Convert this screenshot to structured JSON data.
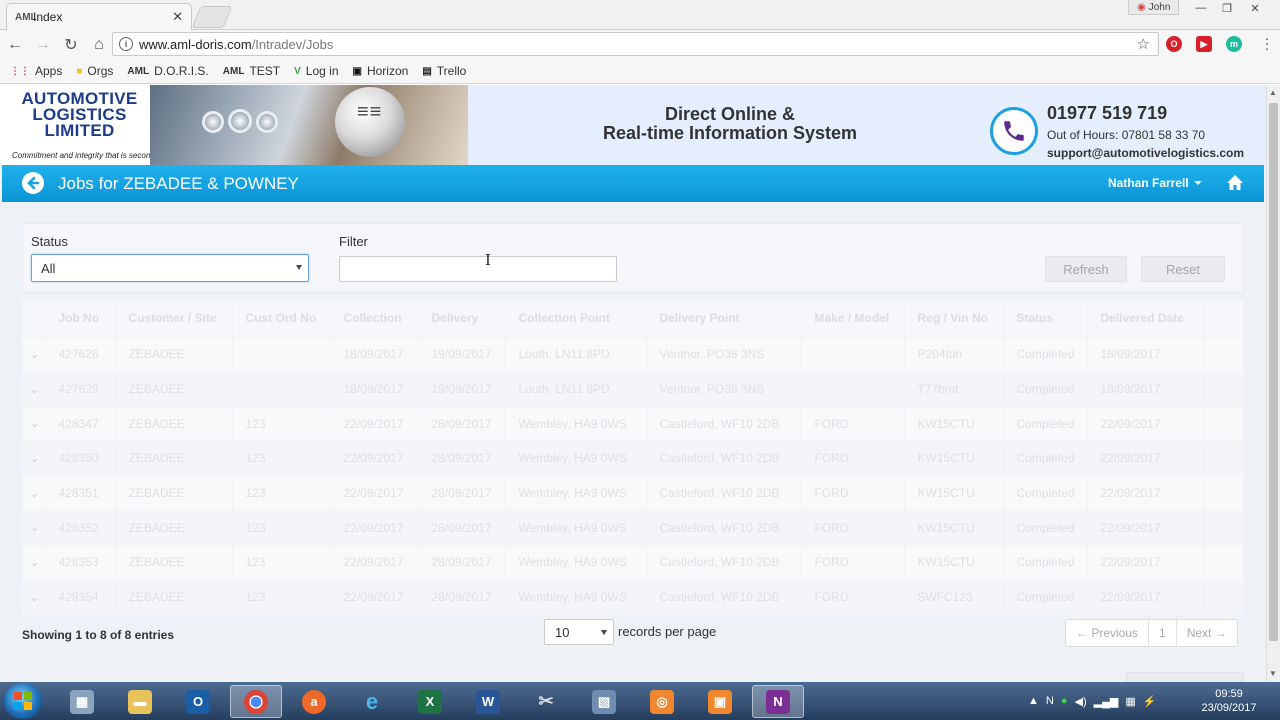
{
  "browser": {
    "tab_title": "Index",
    "tab_favicon": "AML",
    "profile_name": "John",
    "url_host": "www.aml-doris.com",
    "url_path": "/Intradev/Jobs",
    "bookmarks": [
      {
        "label": "Apps",
        "icon": "apps-grid-icon"
      },
      {
        "label": "Orgs",
        "icon": "folder-icon"
      },
      {
        "label": "D.O.R.I.S.",
        "icon": "aml-icon"
      },
      {
        "label": "TEST",
        "icon": "aml-icon"
      },
      {
        "label": "Log in",
        "icon": "vine-icon"
      },
      {
        "label": "Horizon",
        "icon": "horizon-icon"
      },
      {
        "label": "Trello",
        "icon": "trello-icon"
      }
    ]
  },
  "header": {
    "logo_lines": [
      "AUTOMOTIVE",
      "LOGISTICS",
      "LIMITED"
    ],
    "logo_tagline": "Commitment and integrity that is second to none",
    "system_title_1": "Direct Online &",
    "system_title_2": "Real-time Information System",
    "phone": "01977 519 719",
    "out_of_hours": "Out of Hours: 07801 58 33 70",
    "email": "support@automotivelogistics.com"
  },
  "bar": {
    "title": "Jobs for ZEBADEE & POWNEY",
    "user": "Nathan Farrell"
  },
  "filters": {
    "status_label": "Status",
    "status_value": "All",
    "filter_label": "Filter",
    "filter_value": "",
    "refresh_label": "Refresh",
    "reset_label": "Reset"
  },
  "table": {
    "columns": [
      "Job No",
      "Customer / Site",
      "Cust Ord No",
      "Collection",
      "Delivery",
      "Collection Point",
      "Delivery Point",
      "Make / Model",
      "Reg / Vin No",
      "Status",
      "Delivered Date"
    ],
    "rows": [
      [
        "427626",
        "ZEBADEE",
        "",
        "18/09/2017",
        "19/09/2017",
        "Louth, LN11 8PD",
        "Ventnor, PO38 3NS",
        "",
        "P204tdn",
        "Completed",
        "18/09/2017"
      ],
      [
        "427629",
        "ZEBADEE",
        "",
        "18/09/2017",
        "19/09/2017",
        "Louth, LN11 8PD",
        "Ventnor, PO38 3NS",
        "",
        "T77bmt",
        "Completed",
        "18/09/2017"
      ],
      [
        "428347",
        "ZEBADEE",
        "123",
        "22/09/2017",
        "28/09/2017",
        "Wembley, HA9 0WS",
        "Castleford, WF10 2DB",
        "FORD",
        "KW15CTU",
        "Completed",
        "22/09/2017"
      ],
      [
        "428350",
        "ZEBADEE",
        "123",
        "22/09/2017",
        "28/09/2017",
        "Wembley, HA9 0WS",
        "Castleford, WF10 2DB",
        "FORD",
        "KW15CTU",
        "Completed",
        "22/09/2017"
      ],
      [
        "428351",
        "ZEBADEE",
        "123",
        "22/09/2017",
        "28/09/2017",
        "Wembley, HA9 0WS",
        "Castleford, WF10 2DB",
        "FORD",
        "KW15CTU",
        "Completed",
        "22/09/2017"
      ],
      [
        "428352",
        "ZEBADEE",
        "123",
        "22/09/2017",
        "28/09/2017",
        "Wembley, HA9 0WS",
        "Castleford, WF10 2DB",
        "FORD",
        "KW15CTU",
        "Completed",
        "22/09/2017"
      ],
      [
        "428353",
        "ZEBADEE",
        "123",
        "22/09/2017",
        "28/09/2017",
        "Wembley, HA9 0WS",
        "Castleford, WF10 2DB",
        "FORD",
        "KW15CTU",
        "Completed",
        "22/09/2017"
      ],
      [
        "428354",
        "ZEBADEE",
        "123",
        "22/09/2017",
        "28/09/2017",
        "Wembley, HA9 0WS",
        "Castleford, WF10 2DB",
        "FORD",
        "SWFC123",
        "Completed",
        "22/09/2017"
      ]
    ]
  },
  "footer": {
    "info": "Showing 1 to 8 of 8 entries",
    "page_size": "10",
    "page_size_label": "records per page",
    "prev_label": "← Previous",
    "current_page": "1",
    "next_label": "Next →"
  },
  "taskbar": {
    "time": "09:59",
    "date": "23/09/2017"
  },
  "colors": {
    "accent_blue": "#14a3e3",
    "logo_blue": "#1c3d8c"
  }
}
